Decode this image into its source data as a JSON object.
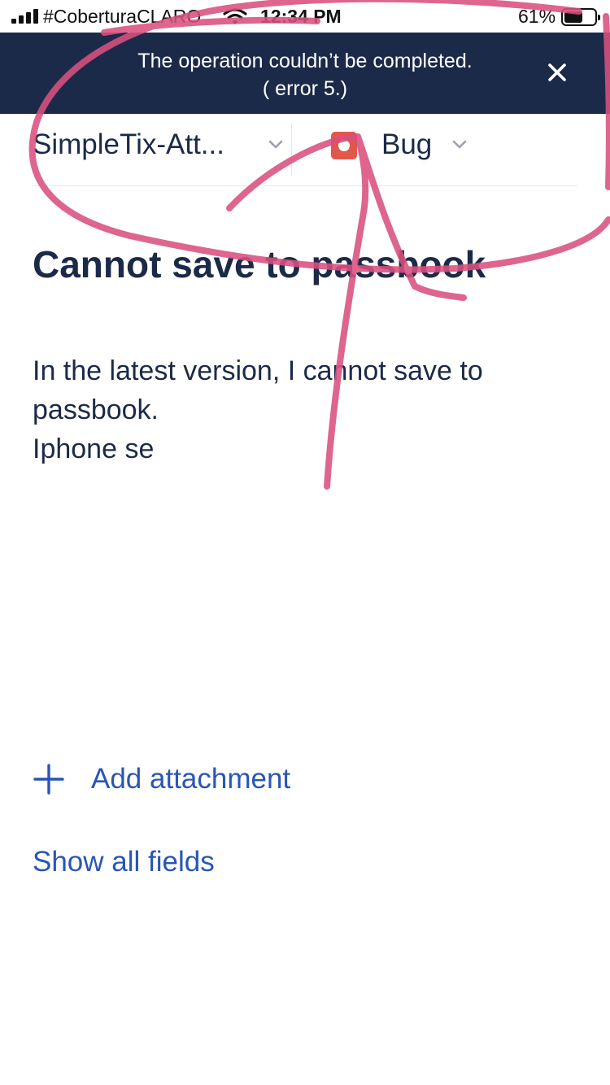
{
  "status_bar": {
    "carrier": "#CoberturaCLARO",
    "time": "12:34 PM",
    "battery_percent": "61%",
    "battery_level": 0.61
  },
  "error_banner": {
    "message_line1": "The operation couldn’t be completed.",
    "message_line2": "( error 5.)",
    "close_icon": "close-icon",
    "background_color": "#1c2a49"
  },
  "selectors": {
    "project_label": "SimpleTix-Att...",
    "issue_type_label": "Bug",
    "issue_type_icon": "bug-icon",
    "issue_type_color": "#e2574c"
  },
  "issue": {
    "title": "Cannot save to passbook",
    "description": "In the latest version, I cannot save to passbook.\nIphone se"
  },
  "actions": {
    "add_attachment_label": "Add attachment",
    "show_all_fields_label": "Show all fields",
    "link_color": "#2856b6"
  },
  "annotation": {
    "color": "#d9507f"
  }
}
